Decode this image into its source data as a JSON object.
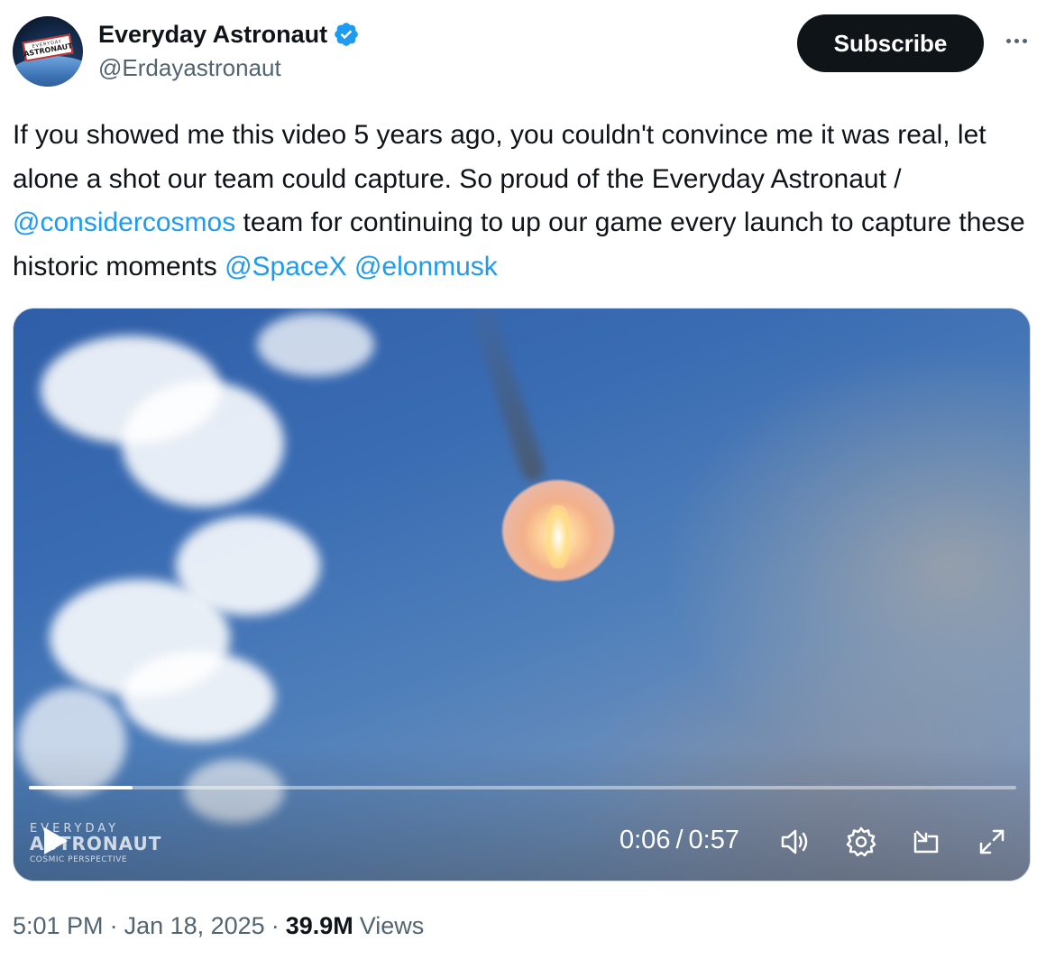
{
  "author": {
    "display_name": "Everyday Astronaut",
    "handle": "@Erdayastronaut",
    "avatar_logo_top": "EVERYDAY",
    "avatar_logo_bottom": "ASTRONAUT",
    "verified": true
  },
  "actions": {
    "subscribe_label": "Subscribe",
    "more_icon": "more-horizontal-icon"
  },
  "tweet": {
    "text_part1": "If you showed me this video 5 years ago, you couldn't convince me it was real, let alone a shot our team could capture. So proud of the Everyday Astronaut / ",
    "mention1": "@considercosmos",
    "text_part2": " team for continuing to up our game every launch to capture these historic moments ",
    "mention2": "@SpaceX",
    "text_part3": " ",
    "mention3": "@elonmusk"
  },
  "video": {
    "current_time": "0:06",
    "separator": "/",
    "duration": "0:57",
    "progress_fraction": 0.105,
    "watermark_top": "EVERYDAY",
    "watermark_mid": "ASTRONAUT",
    "watermark_sub": "COSMIC PERSPECTIVE",
    "controls": [
      "play-icon",
      "volume-icon",
      "settings-gear-icon",
      "pip-icon",
      "fullscreen-expand-icon"
    ]
  },
  "meta": {
    "time": "5:01 PM",
    "dot1": "·",
    "date": "Jan 18, 2025",
    "dot2": "·",
    "views_count": "39.9M",
    "views_label": "Views"
  },
  "colors": {
    "link": "#1d9bf0",
    "text_primary": "#0f1419",
    "text_secondary": "#536471",
    "verified_badge": "#1d9bf0",
    "subscribe_bg": "#0f1419"
  }
}
